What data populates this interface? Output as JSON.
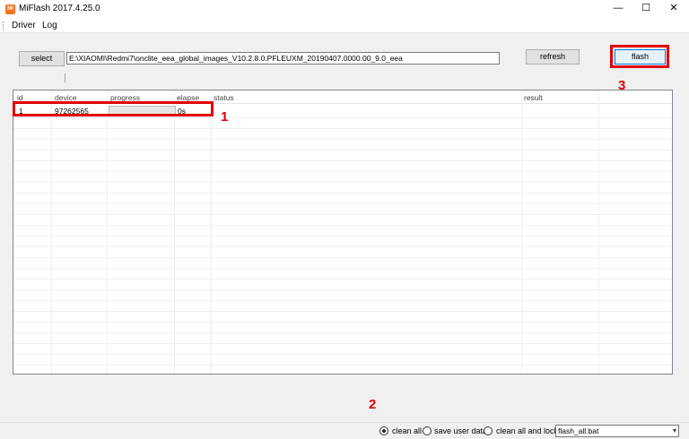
{
  "window": {
    "title": "MiFlash 2017.4.25.0",
    "icon_text": "MI",
    "minimize": "—",
    "maximize": "☐",
    "close": "✕"
  },
  "menu": {
    "items": [
      "Driver",
      "Log"
    ]
  },
  "toolbar": {
    "select_label": "select",
    "path_value": "E:\\XIAOMI\\Redmi7\\onclite_eea_global_images_V10.2.8.0.PFLEUXM_20190407.0000.00_9.0_eea",
    "refresh_label": "refresh",
    "flash_label": "flash"
  },
  "table": {
    "headers": [
      "id",
      "device",
      "progress",
      "elapse",
      "status",
      "result"
    ],
    "rows": [
      {
        "id": "1",
        "device": "97262565",
        "progress": 0,
        "elapse": "0s",
        "status": "",
        "result": ""
      }
    ]
  },
  "annotations": {
    "n1": "1",
    "n2": "2",
    "n3": "3",
    "color": "#e00000"
  },
  "options": {
    "clean_all": "clean all",
    "save_user_data": "save user data",
    "clean_all_and_lock": "clean all and lock",
    "selected": "clean all",
    "script_value": "flash_all.bat",
    "dropdown_arrow": "▾"
  }
}
